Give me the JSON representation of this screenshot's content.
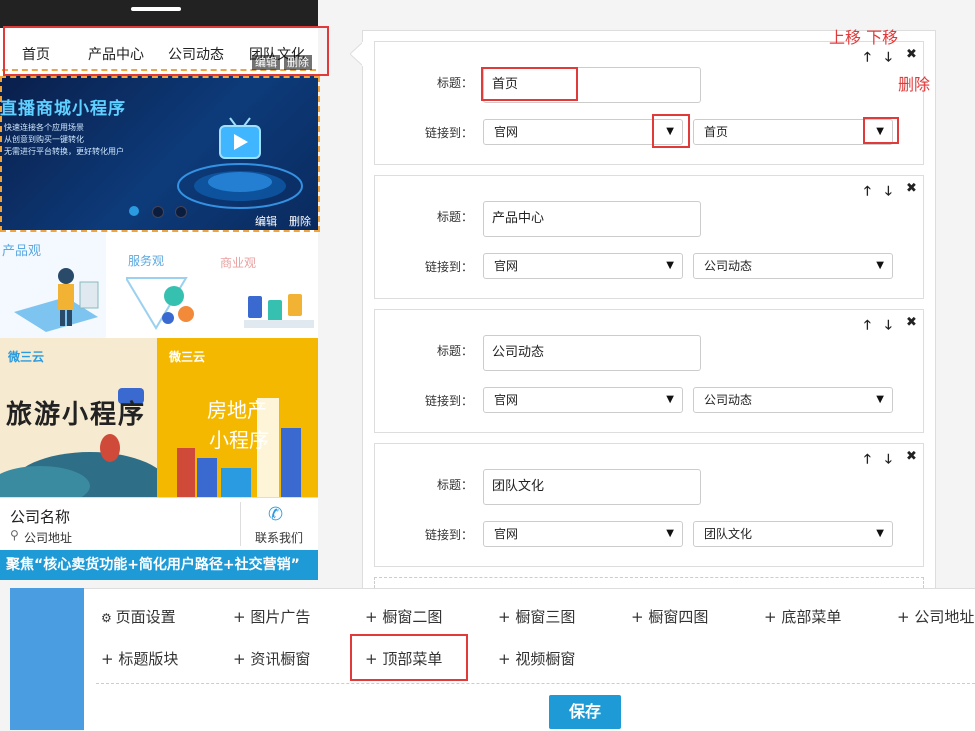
{
  "phone": {
    "nav": [
      "首页",
      "产品中心",
      "公司动态",
      "团队文化"
    ],
    "nav_edit": "编辑",
    "nav_delete": "删除",
    "banner": {
      "title": "直播商城小程序",
      "bullets": [
        "快速连接各个应用场景",
        "从创意到购买一键转化",
        "无需进行平台转换，更好转化用户"
      ],
      "edit": "编辑",
      "delete": "删除"
    },
    "tiles": {
      "t1": "产品观",
      "t2": "服务观",
      "t3": "商业观",
      "travel_brand": "微三云",
      "travel_title": "旅游小程序",
      "estate_brand": "微三云",
      "estate_title1": "房地产",
      "estate_title2": "小程序"
    },
    "company_name": "公司名称",
    "company_address": "公司地址",
    "contact": "联系我们",
    "ticker": "聚焦“核心卖货功能+简化用户路径+社交营销”"
  },
  "annotations": {
    "up_down": "上移 下移",
    "delete": "删除"
  },
  "editor": {
    "title_label": "标题：",
    "link_label": "链接到：",
    "items": [
      {
        "title": "首页",
        "link1": "官网",
        "link2": "首页"
      },
      {
        "title": "产品中心",
        "link1": "官网",
        "link2": "公司动态"
      },
      {
        "title": "公司动态",
        "link1": "官网",
        "link2": "公司动态"
      },
      {
        "title": "团队文化",
        "link1": "官网",
        "link2": "团队文化"
      }
    ],
    "up_icon": "arrow-up-icon",
    "down_icon": "arrow-down-icon",
    "close_icon": "close-icon"
  },
  "toolbar": {
    "row1": [
      "页面设置",
      "图片广告",
      "橱窗二图",
      "橱窗三图",
      "橱窗四图",
      "底部菜单",
      "公司地址"
    ],
    "row2": [
      "标题版块",
      "资讯橱窗",
      "顶部菜单",
      "视频橱窗"
    ],
    "save": "保存"
  },
  "colors": {
    "accent": "#1e9ad6",
    "highlight": "#e03a3a",
    "dashed": "#f2a33a"
  }
}
